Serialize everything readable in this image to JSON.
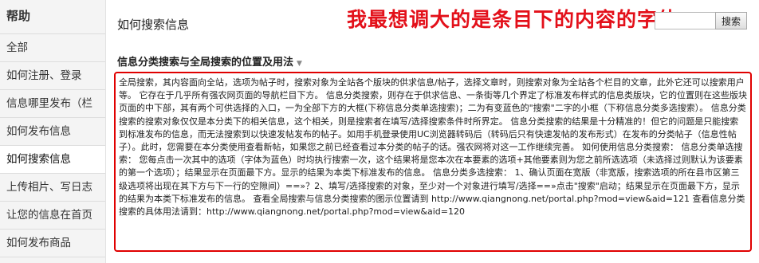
{
  "sidebar": {
    "title": "帮助",
    "items": [
      {
        "label": "全部"
      },
      {
        "label": "如何注册、登录"
      },
      {
        "label": "信息哪里发布（栏"
      },
      {
        "label": "如何发布信息"
      },
      {
        "label": "如何搜索信息"
      },
      {
        "label": "上传相片、写日志"
      },
      {
        "label": "让您的信息在首页"
      },
      {
        "label": "如何发布商品"
      }
    ],
    "active_index": 4
  },
  "header": {
    "title": "如何搜索信息",
    "annotation": "我最想调大的是条目下的内容的字体",
    "annotation_color": "#e3101a",
    "search_value": "",
    "search_button": "搜索"
  },
  "section": {
    "title": "信息分类搜索与全局搜索的位置及用法",
    "chevron_icon": "chevron-down-icon",
    "body": "全局搜索，其内容面向全站，选项为帖子时，搜索对象为全站各个版块的供求信息/帖子，选择文章时，则搜索对象为全站各个栏目的文章，此外它还可以搜索用户等。 它存在于几乎所有强农网页面的导航栏目下方。 信息分类搜索，则存在于供求信息、一条街等几个界定了标准发布样式的信息类版块，它的位置则在这些版块页面的中下部，其有两个可供选择的入口，一为全部下方的大框(下称信息分类单选搜索)；二为有变蓝色的\"搜索\"二字的小框（下称信息分类多选搜索）。 信息分类搜索的搜索对象仅仅是本分类下的相关信息，这个相关，则是搜索者在填写/选择搜索条件时所界定。 信息分类搜索的结果是十分精准的！但它的问题是只能搜索到标准发布的信息，而无法搜索到以快速发帖发布的帖子。如用手机登录使用UC浏览器转码后（转码后只有快速发帖的发布形式）在发布的分类帖子（信息性帖子）。此时，您需要在本分类使用查看新帖，如果您之前已经查看过本分类的帖子的话。强农网将对这一工作继续完善。 如何使用信息分类搜索： 信息分类单选搜索： 您每点击一次其中的选项（字体为蓝色）时均执行搜索一次，这个结果将是您本次在本要素的选项+其他要素则为您之前所选选项（未选择过则默认为该要素的第一个选项）；结果显示在页面最下方。显示的结果为本类下标准发布的信息。 信息分类多选搜索： 1、确认页面在宽版（非宽版，搜索选项的所在县市区第三级选项将出现在其下方与下一行的空隙间）==»？2、填写/选择搜索的对象，至少对一个对象进行填写/选择==»点击\"搜索\"启动；结果显示在页面最下方，显示的结果为本类下标准发布的信息。 查看全局搜索与信息分类搜索的图示位置请到 ",
    "link1": "http://www.qiangnong.net/portal.php?mod=view&aid=121",
    "mid_text": " 查看信息分类搜索的具体用法请到：",
    "link2": "http://www.qiangnong.net/portal.php?mod=view&aid=120",
    "highlight_border_color": "#e00000"
  }
}
